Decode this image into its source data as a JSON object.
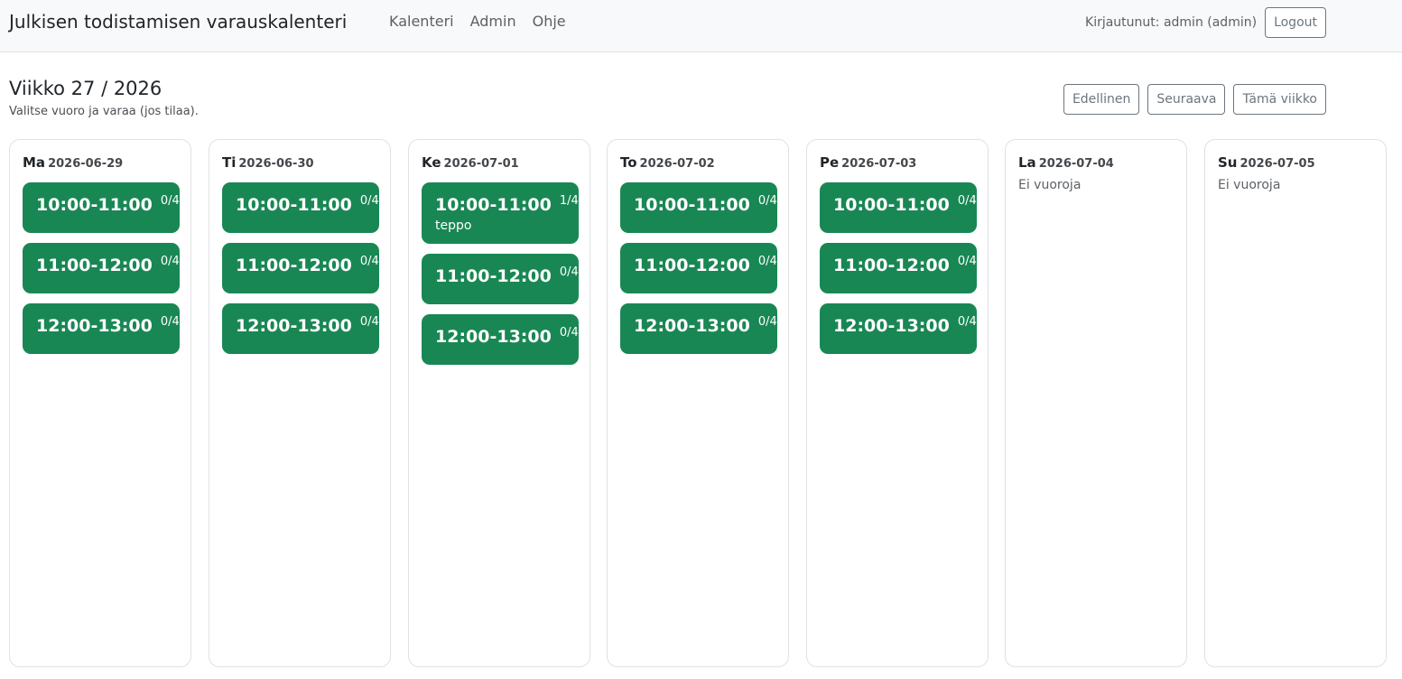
{
  "navbar": {
    "brand": "Julkisen todistamisen varauskalenteri",
    "links": [
      "Kalenteri",
      "Admin",
      "Ohje"
    ],
    "user_text": "Kirjautunut: admin (admin)",
    "logout_label": "Logout"
  },
  "week": {
    "title": "Viikko 27 / 2026",
    "subtitle": "Valitse vuoro ja varaa (jos tilaa).",
    "prev_label": "Edellinen",
    "next_label": "Seuraava",
    "current_label": "Tämä viikko"
  },
  "colors": {
    "slot_green": "#198754",
    "navbar_bg": "#f8f9fa"
  },
  "days": [
    {
      "name": "Ma",
      "date": "2026-06-29",
      "empty_text": "",
      "slots": [
        {
          "time": "10:00-11:00",
          "count": "0/4",
          "booker": ""
        },
        {
          "time": "11:00-12:00",
          "count": "0/4",
          "booker": ""
        },
        {
          "time": "12:00-13:00",
          "count": "0/4",
          "booker": ""
        }
      ]
    },
    {
      "name": "Ti",
      "date": "2026-06-30",
      "empty_text": "",
      "slots": [
        {
          "time": "10:00-11:00",
          "count": "0/4",
          "booker": ""
        },
        {
          "time": "11:00-12:00",
          "count": "0/4",
          "booker": ""
        },
        {
          "time": "12:00-13:00",
          "count": "0/4",
          "booker": ""
        }
      ]
    },
    {
      "name": "Ke",
      "date": "2026-07-01",
      "empty_text": "",
      "slots": [
        {
          "time": "10:00-11:00",
          "count": "1/4",
          "booker": "teppo"
        },
        {
          "time": "11:00-12:00",
          "count": "0/4",
          "booker": ""
        },
        {
          "time": "12:00-13:00",
          "count": "0/4",
          "booker": ""
        }
      ]
    },
    {
      "name": "To",
      "date": "2026-07-02",
      "empty_text": "",
      "slots": [
        {
          "time": "10:00-11:00",
          "count": "0/4",
          "booker": ""
        },
        {
          "time": "11:00-12:00",
          "count": "0/4",
          "booker": ""
        },
        {
          "time": "12:00-13:00",
          "count": "0/4",
          "booker": ""
        }
      ]
    },
    {
      "name": "Pe",
      "date": "2026-07-03",
      "empty_text": "",
      "slots": [
        {
          "time": "10:00-11:00",
          "count": "0/4",
          "booker": ""
        },
        {
          "time": "11:00-12:00",
          "count": "0/4",
          "booker": ""
        },
        {
          "time": "12:00-13:00",
          "count": "0/4",
          "booker": ""
        }
      ]
    },
    {
      "name": "La",
      "date": "2026-07-04",
      "empty_text": "Ei vuoroja",
      "slots": []
    },
    {
      "name": "Su",
      "date": "2026-07-05",
      "empty_text": "Ei vuoroja",
      "slots": []
    }
  ]
}
